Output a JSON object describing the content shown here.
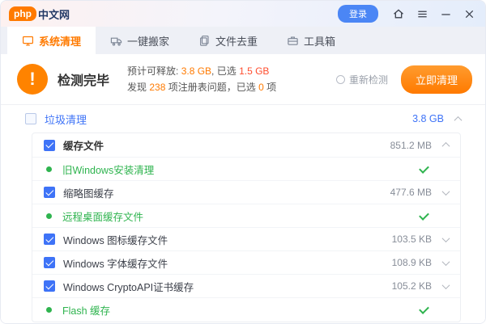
{
  "colors": {
    "accent_orange": "#ff7a00",
    "accent_blue": "#3e73f7",
    "success_green": "#2fb44f",
    "login_blue": "#4b86f5"
  },
  "titlebar": {
    "logo_php": "php",
    "logo_suffix": "中文网",
    "login_label": "登录"
  },
  "tabs": [
    {
      "label": "系统清理",
      "active": true
    },
    {
      "label": "一键搬家",
      "active": false
    },
    {
      "label": "文件去重",
      "active": false
    },
    {
      "label": "工具箱",
      "active": false
    }
  ],
  "status": {
    "title": "检测完毕",
    "line1_prefix": "预计可释放: ",
    "line1_value1": "3.8 GB",
    "line1_mid": ", 已选 ",
    "line1_value2": "1.5 GB",
    "line2_prefix": "发现 ",
    "line2_value1": "238",
    "line2_mid": " 项注册表问题，已选 ",
    "line2_value2": "0",
    "line2_suffix": " 项",
    "recheck_label": "重新检测",
    "clean_button_label": "立即清理"
  },
  "list": {
    "group_label": "垃圾清理",
    "group_size": "3.8 GB",
    "subgroup_label": "缓存文件",
    "subgroup_size": "851.2 MB",
    "items": [
      {
        "label": "旧Windows安装清理",
        "size": "",
        "state": "done"
      },
      {
        "label": "缩略图缓存",
        "size": "477.6 MB",
        "state": "checked"
      },
      {
        "label": "远程桌面缓存文件",
        "size": "",
        "state": "done"
      },
      {
        "label": "Windows 图标缓存文件",
        "size": "103.5 KB",
        "state": "checked"
      },
      {
        "label": "Windows 字体缓存文件",
        "size": "108.9 KB",
        "state": "checked"
      },
      {
        "label": "Windows CryptoAPI证书缓存",
        "size": "105.2 KB",
        "state": "checked"
      },
      {
        "label": "Flash 缓存",
        "size": "",
        "state": "done"
      }
    ]
  }
}
